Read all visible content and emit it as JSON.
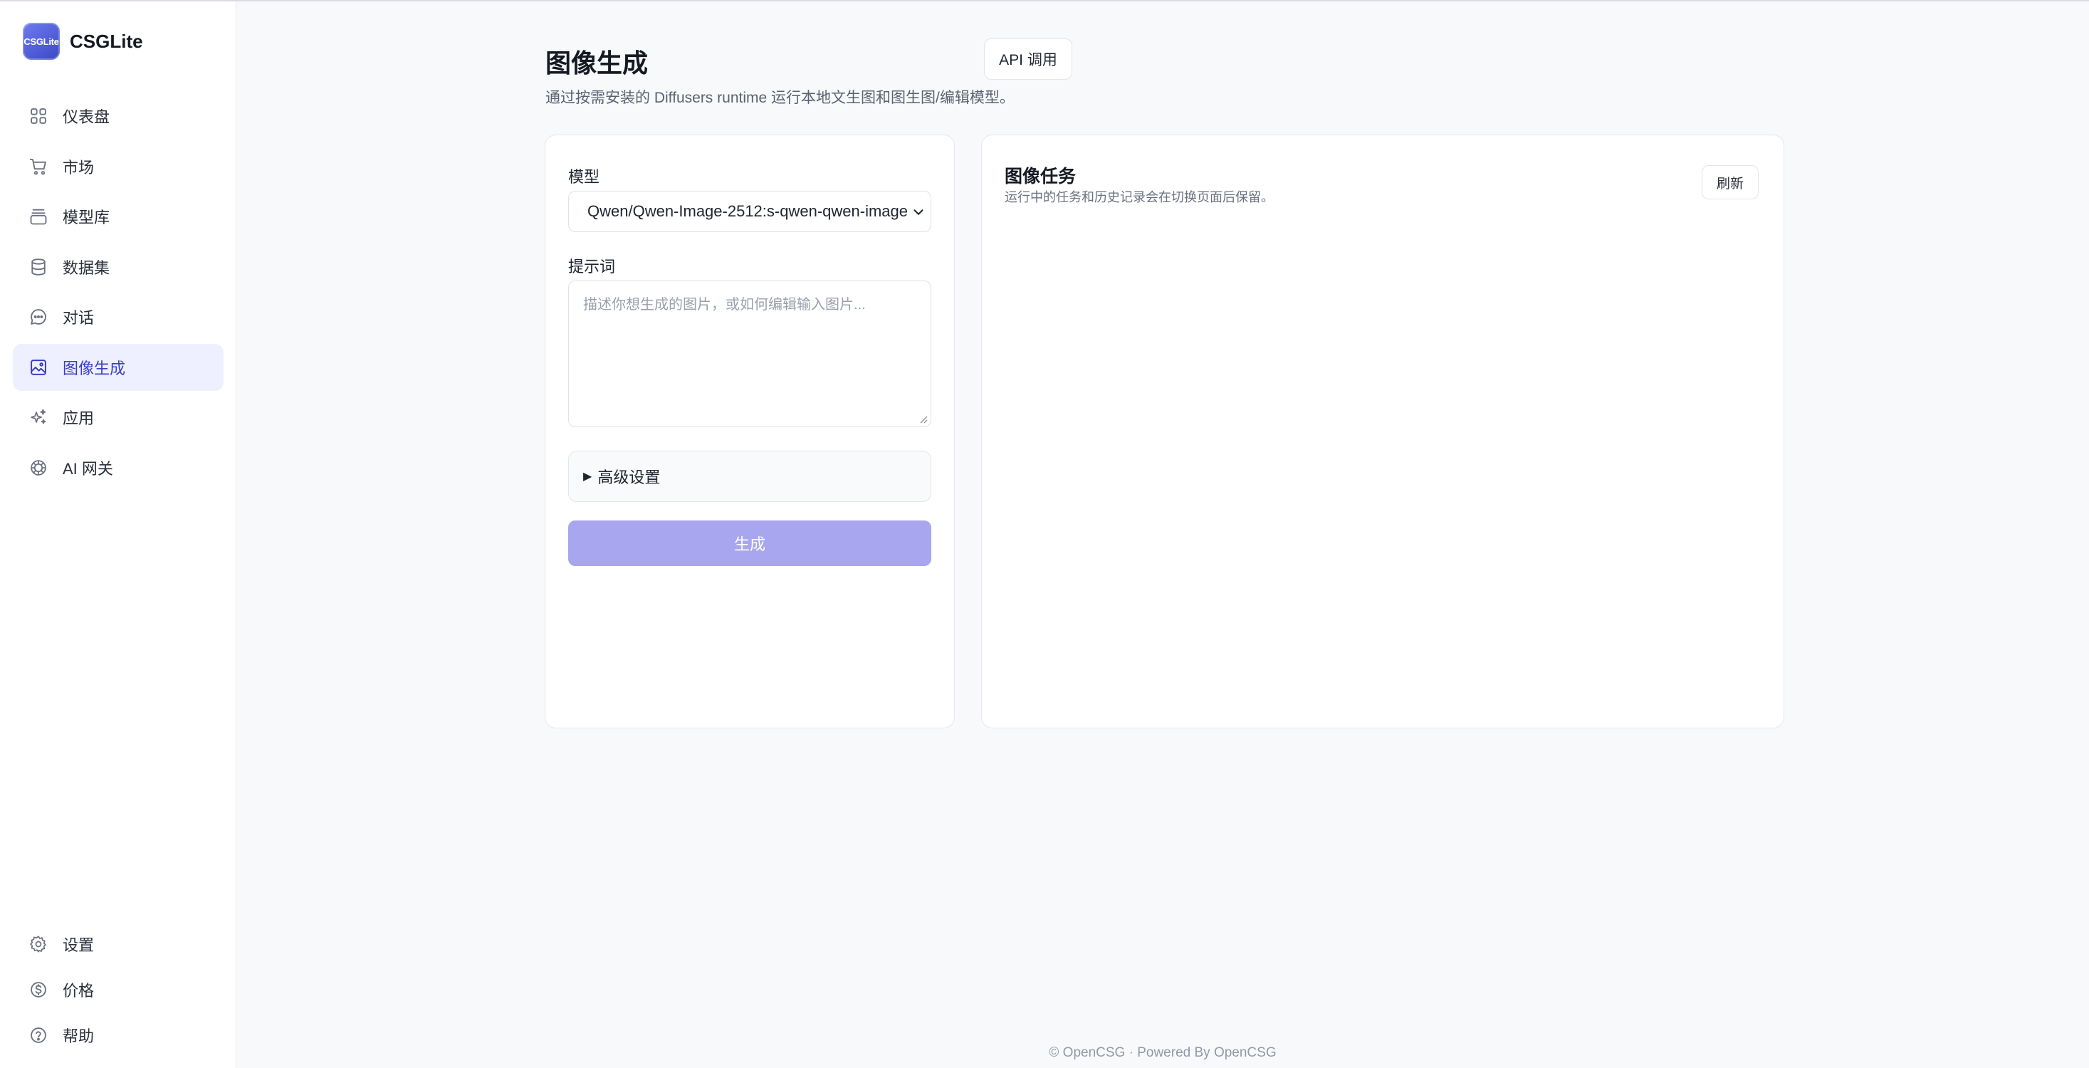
{
  "brand": {
    "logo_text": "CSGLite",
    "name": "CSGLite"
  },
  "sidebar": {
    "items": [
      {
        "label": "仪表盘",
        "icon": "dashboard-icon"
      },
      {
        "label": "市场",
        "icon": "cart-icon"
      },
      {
        "label": "模型库",
        "icon": "model-library-icon"
      },
      {
        "label": "数据集",
        "icon": "database-icon"
      },
      {
        "label": "对话",
        "icon": "chat-icon"
      },
      {
        "label": "图像生成",
        "icon": "image-icon",
        "active": true
      },
      {
        "label": "应用",
        "icon": "sparkles-icon"
      },
      {
        "label": "AI 网关",
        "icon": "ai-gateway-icon"
      }
    ],
    "bottom_items": [
      {
        "label": "设置",
        "icon": "gear-icon"
      },
      {
        "label": "价格",
        "icon": "dollar-icon"
      },
      {
        "label": "帮助",
        "icon": "help-icon"
      }
    ]
  },
  "header": {
    "title": "图像生成",
    "description": "通过按需安装的 Diffusers runtime 运行本地文生图和图生图/编辑模型。",
    "api_button": "API 调用"
  },
  "form": {
    "model_label": "模型",
    "model_value": "Qwen/Qwen-Image-2512:s-qwen-qwen-image",
    "prompt_label": "提示词",
    "prompt_placeholder": "描述你想生成的图片，或如何编辑输入图片...",
    "advanced_label": "高级设置",
    "generate_button": "生成"
  },
  "tasks": {
    "title": "图像任务",
    "description": "运行中的任务和历史记录会在切换页面后保留。",
    "refresh_button": "刷新"
  },
  "footer": {
    "text": "© OpenCSG · Powered By OpenCSG"
  },
  "colors": {
    "accent": "#3b3fbf",
    "active_bg": "#eef0ff",
    "generate_disabled": "#a7a6ee"
  }
}
